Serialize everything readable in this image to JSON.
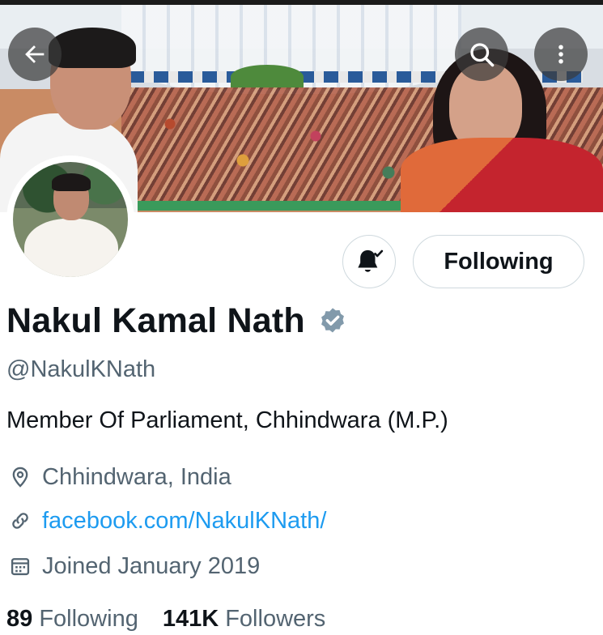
{
  "profile": {
    "name": "Nakul Kamal Nath",
    "handle": "@NakulKNath",
    "bio": "Member Of Parliament, Chhindwara (M.P.)",
    "location": "Chhindwara, India",
    "website": "facebook.com/NakulKNath/",
    "joined": "Joined January 2019",
    "verified": true
  },
  "actions": {
    "following_label": "Following"
  },
  "stats": {
    "following_count": "89",
    "following_label": "Following",
    "followers_count": "141K",
    "followers_label": "Followers"
  },
  "icons": {
    "back": "back-arrow-icon",
    "search": "search-icon",
    "more": "more-vertical-icon",
    "notifications": "bell-check-icon",
    "verified": "verified-badge-icon",
    "location": "location-pin-icon",
    "link": "link-icon",
    "calendar": "calendar-icon"
  },
  "colors": {
    "link": "#1d9bf0",
    "secondary_text": "#536471",
    "verified_badge": "#829aab"
  }
}
